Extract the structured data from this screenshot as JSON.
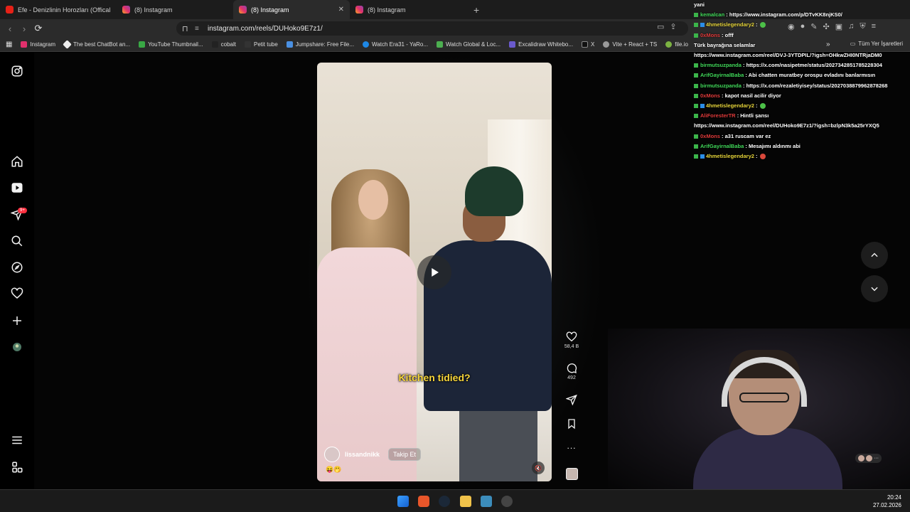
{
  "browser": {
    "tabs": [
      {
        "title": "Efe - Denizlinin Horozları (Offical Vid",
        "icon": "youtube-icon",
        "active": false
      },
      {
        "title": "(8) Instagram",
        "icon": "instagram-icon",
        "active": false
      },
      {
        "title": "(8) Instagram",
        "icon": "instagram-icon",
        "active": true
      },
      {
        "title": "(8) Instagram",
        "icon": "instagram-icon",
        "active": false
      }
    ],
    "new_tab": "+",
    "url": "instagram.com/reels/DUHoko9E7z1/",
    "bookmarks": [
      "Instagram",
      "The best ChatBot an...",
      "YouTube Thumbnail...",
      "cobalt",
      "Petit tube",
      "Jumpshare: Free File...",
      "Watch Era31 - YaRo...",
      "Watch Global & Loc...",
      "Excalidraw Whitebo...",
      "X",
      "Vite + React + TS",
      "file.io"
    ],
    "bookmarks_overflow": "»",
    "all_bookmarks": "Tüm Yer İşaretleri"
  },
  "reel": {
    "caption": "Kitchen tidied?",
    "author": "lissandnikk",
    "follow_label": "Takip Et",
    "emojis": "😝🤭",
    "likes": "58,4 B",
    "comments": "492",
    "more": "..."
  },
  "sidebar": {
    "notification_badge": "9+"
  },
  "chat": [
    {
      "user": "",
      "text": "yani",
      "color": "white"
    },
    {
      "user": "kemalcan",
      "text": ": https://www.instagram.com/p/DTvKK8njKS0/",
      "color": "green"
    },
    {
      "user": "4hmetislegendary2",
      "text": ":",
      "color": "yellow"
    },
    {
      "user": "0xMons",
      "text": ": offf",
      "color": "red"
    },
    {
      "user": "",
      "text": "Türk bayrağına selamlar",
      "color": "white"
    },
    {
      "user": "",
      "text": "https://www.instagram.com/reel/DVJ-3YTDPIL/?igsh=OHkwZHI0NTRjaDM0",
      "color": "white"
    },
    {
      "user": "birmutsuzpanda",
      "text": ": https://x.com/nasipetme/status/2027342851785228304",
      "color": "green"
    },
    {
      "user": "ArifGayirnalBaba",
      "text": ": Abi chatten muratbey orospu evladını banlarmısın",
      "color": "green"
    },
    {
      "user": "birmutsuzpanda",
      "text": ": https://x.com/rezaletiyisey/status/2027038879962878268",
      "color": "green"
    },
    {
      "user": "0xMons",
      "text": ": kapot nasil acilir diyor",
      "color": "red"
    },
    {
      "user": "4hmetislegendary2",
      "text": ":",
      "color": "yellow"
    },
    {
      "user": "AliForesterTR",
      "text": ": Hintli şansı",
      "color": "red"
    },
    {
      "user": "",
      "text": "https://www.instagram.com/reel/DUHoko9E7z1/?igsh=bzlpN3k5a25rYXQ5",
      "color": "white"
    },
    {
      "user": "0xMons",
      "text": ": a31 ruscam var ez",
      "color": "red"
    },
    {
      "user": "ArifGayirnalBaba",
      "text": ": Mesajımı aldınmı abi",
      "color": "green"
    },
    {
      "user": "4hmetislegendary2",
      "text": ":",
      "color": "yellow"
    }
  ],
  "taskbar": {
    "time": "20:24",
    "date": "27.02.2026"
  },
  "colors": {
    "accent_red": "#ff3040",
    "caption_yellow": "#f6d53a"
  }
}
